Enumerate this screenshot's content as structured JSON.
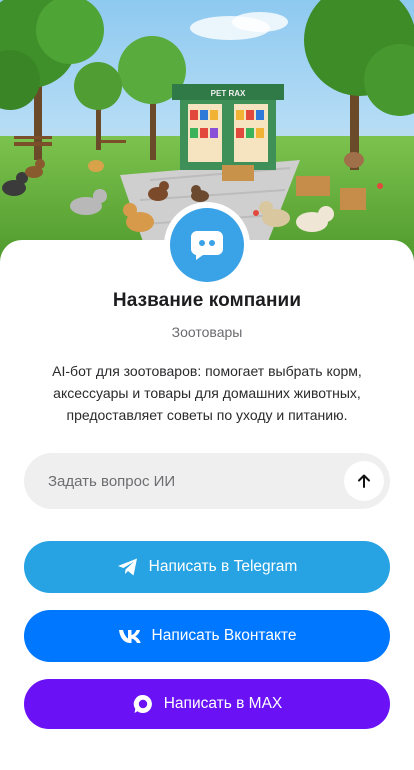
{
  "hero": {
    "kiosk_sign": "PET RAX",
    "image_icon": "pet-shop-park-illustration"
  },
  "profile": {
    "avatar_icon": "chat-bubble-icon",
    "avatar_color": "#3aa2e6",
    "company_name": "Название компании",
    "category": "Зоотовары",
    "description": "AI-бот для зоотоваров: помогает выбрать корм, аксессуары и товары для домашних животных, предоставляет советы по уходу и питанию."
  },
  "ask": {
    "placeholder": "Задать вопрос ИИ",
    "value": "",
    "send_icon": "arrow-up-icon"
  },
  "buttons": {
    "telegram": {
      "label": "Написать в Telegram",
      "icon": "telegram-icon",
      "color": "#27a3e3"
    },
    "vk": {
      "label": "Написать Вконтакте",
      "icon": "vk-icon",
      "color": "#0077ff"
    },
    "max": {
      "label": "Написать в MAX",
      "icon": "max-icon",
      "color": "#6a11f5"
    }
  }
}
